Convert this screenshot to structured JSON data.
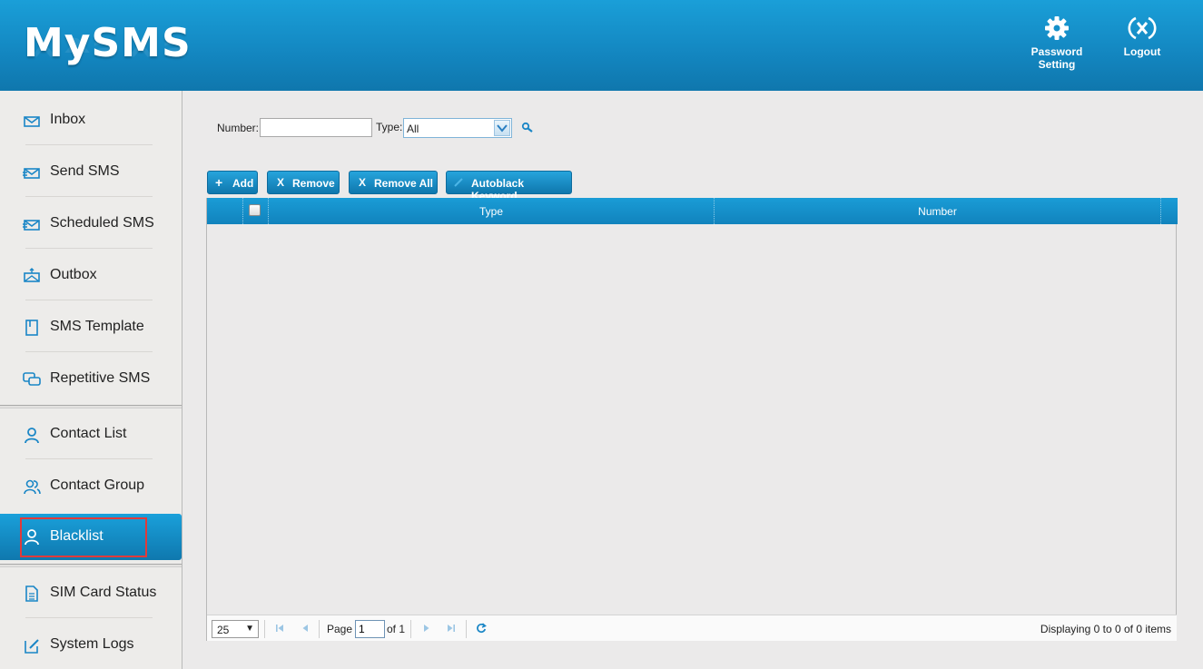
{
  "app": {
    "logo": "MySMS"
  },
  "header": {
    "password_setting": "Password Setting",
    "logout": "Logout"
  },
  "sidebar": {
    "items": [
      {
        "label": "Inbox",
        "icon": "envelope-icon"
      },
      {
        "label": "Send SMS",
        "icon": "send-envelope-icon"
      },
      {
        "label": "Scheduled SMS",
        "icon": "scheduled-envelope-icon"
      },
      {
        "label": "Outbox",
        "icon": "outbox-envelope-icon"
      },
      {
        "label": "SMS Template",
        "icon": "template-icon"
      },
      {
        "label": "Repetitive SMS",
        "icon": "chat-icon"
      },
      {
        "label": "Contact List",
        "icon": "user-icon"
      },
      {
        "label": "Contact Group",
        "icon": "users-icon"
      },
      {
        "label": "Blacklist",
        "icon": "user-icon",
        "active": true
      },
      {
        "label": "SIM Card Status",
        "icon": "document-icon"
      },
      {
        "label": "System Logs",
        "icon": "edit-icon"
      }
    ]
  },
  "filter": {
    "number_label": "Number:",
    "number_value": "",
    "type_label": "Type:",
    "type_value": "All"
  },
  "toolbar": {
    "add": "Add",
    "remove": "Remove",
    "remove_all": "Remove All",
    "autoblack": "Autoblack Keyword"
  },
  "grid": {
    "columns": [
      "Type",
      "Number"
    ],
    "rows": []
  },
  "pager": {
    "page_size": "25",
    "page_label": "Page",
    "page_value": "1",
    "of_label": "of 1",
    "display": "Displaying 0 to 0 of 0 items"
  },
  "colors": {
    "accent": "#1386c0",
    "active_outline": "#e03a3a"
  }
}
